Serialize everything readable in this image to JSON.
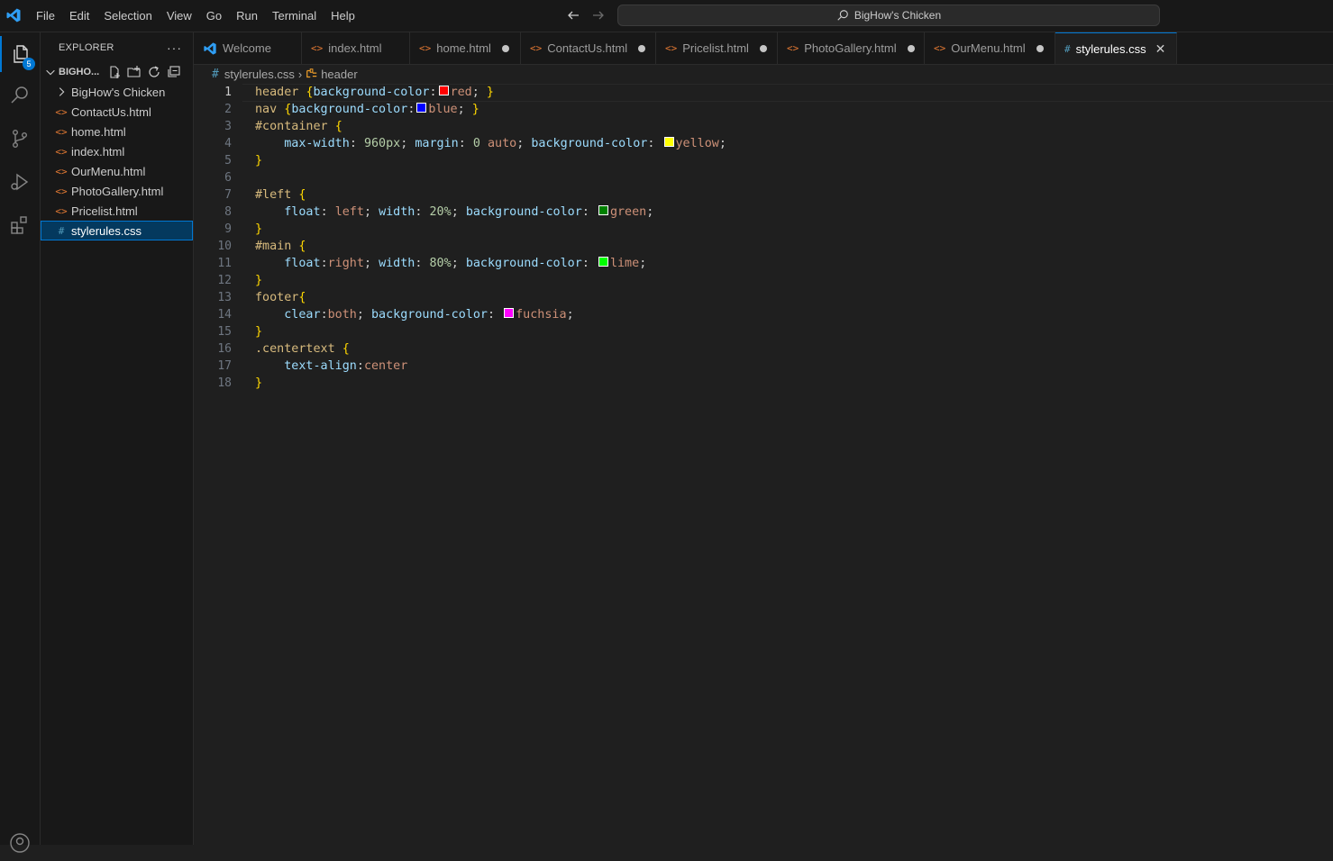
{
  "menu": [
    "File",
    "Edit",
    "Selection",
    "View",
    "Go",
    "Run",
    "Terminal",
    "Help"
  ],
  "command_center": {
    "text": "BigHow's Chicken"
  },
  "activity": {
    "explorer_badge": "5"
  },
  "sidebar": {
    "title": "EXPLORER",
    "more": "···",
    "folder": "BIGHO...",
    "items": [
      {
        "label": "BigHow's Chicken",
        "type": "folder"
      },
      {
        "label": "ContactUs.html",
        "type": "html"
      },
      {
        "label": "home.html",
        "type": "html"
      },
      {
        "label": "index.html",
        "type": "html"
      },
      {
        "label": "OurMenu.html",
        "type": "html"
      },
      {
        "label": "PhotoGallery.html",
        "type": "html"
      },
      {
        "label": "Pricelist.html",
        "type": "html"
      },
      {
        "label": "stylerules.css",
        "type": "css",
        "selected": true
      }
    ]
  },
  "tabs": [
    {
      "label": "Welcome",
      "type": "welcome",
      "modified": false
    },
    {
      "label": "index.html",
      "type": "html",
      "modified": false
    },
    {
      "label": "home.html",
      "type": "html",
      "modified": true
    },
    {
      "label": "ContactUs.html",
      "type": "html",
      "modified": true
    },
    {
      "label": "Pricelist.html",
      "type": "html",
      "modified": true
    },
    {
      "label": "PhotoGallery.html",
      "type": "html",
      "modified": true
    },
    {
      "label": "OurMenu.html",
      "type": "html",
      "modified": true
    },
    {
      "label": "stylerules.css",
      "type": "css",
      "active": true
    }
  ],
  "breadcrumb": {
    "file": "stylerules.css",
    "symbol": "header"
  },
  "colors": {
    "red": "#ff0000",
    "blue": "#0000ff",
    "yellow": "#ffff00",
    "green": "#008000",
    "lime": "#00ff00",
    "fuchsia": "#ff00ff"
  },
  "code_lines": [
    [
      [
        "sel",
        "header "
      ],
      [
        "brace",
        "{"
      ],
      [
        "prop",
        "background-color"
      ],
      [
        "punct",
        ":"
      ],
      [
        "swatch",
        "#ff0000"
      ],
      [
        "val",
        "red"
      ],
      [
        "punct",
        "; "
      ],
      [
        "brace",
        "}"
      ]
    ],
    [
      [
        "sel",
        "nav "
      ],
      [
        "brace",
        "{"
      ],
      [
        "prop",
        "background-color"
      ],
      [
        "punct",
        ":"
      ],
      [
        "swatch",
        "#0000ff"
      ],
      [
        "val",
        "blue"
      ],
      [
        "punct",
        "; "
      ],
      [
        "brace",
        "}"
      ]
    ],
    [
      [
        "sel",
        "#container "
      ],
      [
        "brace",
        "{"
      ]
    ],
    [
      [
        "punct",
        "    "
      ],
      [
        "prop",
        "max-width"
      ],
      [
        "punct",
        ": "
      ],
      [
        "num",
        "960px"
      ],
      [
        "punct",
        "; "
      ],
      [
        "prop",
        "margin"
      ],
      [
        "punct",
        ": "
      ],
      [
        "num",
        "0"
      ],
      [
        "punct",
        " "
      ],
      [
        "val",
        "auto"
      ],
      [
        "punct",
        "; "
      ],
      [
        "prop",
        "background-color"
      ],
      [
        "punct",
        ": "
      ],
      [
        "swatch",
        "#ffff00"
      ],
      [
        "val",
        "yellow"
      ],
      [
        "punct",
        ";"
      ]
    ],
    [
      [
        "brace",
        "}"
      ]
    ],
    [],
    [
      [
        "sel",
        "#left "
      ],
      [
        "brace",
        "{"
      ]
    ],
    [
      [
        "punct",
        "    "
      ],
      [
        "prop",
        "float"
      ],
      [
        "punct",
        ": "
      ],
      [
        "val",
        "left"
      ],
      [
        "punct",
        "; "
      ],
      [
        "prop",
        "width"
      ],
      [
        "punct",
        ": "
      ],
      [
        "num",
        "20%"
      ],
      [
        "punct",
        "; "
      ],
      [
        "prop",
        "background-color"
      ],
      [
        "punct",
        ": "
      ],
      [
        "swatch",
        "#008000"
      ],
      [
        "val",
        "green"
      ],
      [
        "punct",
        ";"
      ]
    ],
    [
      [
        "brace",
        "}"
      ]
    ],
    [
      [
        "sel",
        "#main "
      ],
      [
        "brace",
        "{"
      ]
    ],
    [
      [
        "punct",
        "    "
      ],
      [
        "prop",
        "float"
      ],
      [
        "punct",
        ":"
      ],
      [
        "val",
        "right"
      ],
      [
        "punct",
        "; "
      ],
      [
        "prop",
        "width"
      ],
      [
        "punct",
        ": "
      ],
      [
        "num",
        "80%"
      ],
      [
        "punct",
        "; "
      ],
      [
        "prop",
        "background-color"
      ],
      [
        "punct",
        ": "
      ],
      [
        "swatch",
        "#00ff00"
      ],
      [
        "val",
        "lime"
      ],
      [
        "punct",
        ";"
      ]
    ],
    [
      [
        "brace",
        "}"
      ]
    ],
    [
      [
        "sel",
        "footer"
      ],
      [
        "brace",
        "{"
      ]
    ],
    [
      [
        "punct",
        "    "
      ],
      [
        "prop",
        "clear"
      ],
      [
        "punct",
        ":"
      ],
      [
        "val",
        "both"
      ],
      [
        "punct",
        "; "
      ],
      [
        "prop",
        "background-color"
      ],
      [
        "punct",
        ": "
      ],
      [
        "swatch",
        "#ff00ff"
      ],
      [
        "val",
        "fuchsia"
      ],
      [
        "punct",
        ";"
      ]
    ],
    [
      [
        "brace",
        "}"
      ]
    ],
    [
      [
        "sel",
        ".centertext "
      ],
      [
        "brace",
        "{"
      ]
    ],
    [
      [
        "punct",
        "    "
      ],
      [
        "prop",
        "text-align"
      ],
      [
        "punct",
        ":"
      ],
      [
        "val",
        "center"
      ]
    ],
    [
      [
        "brace",
        "}"
      ]
    ]
  ]
}
